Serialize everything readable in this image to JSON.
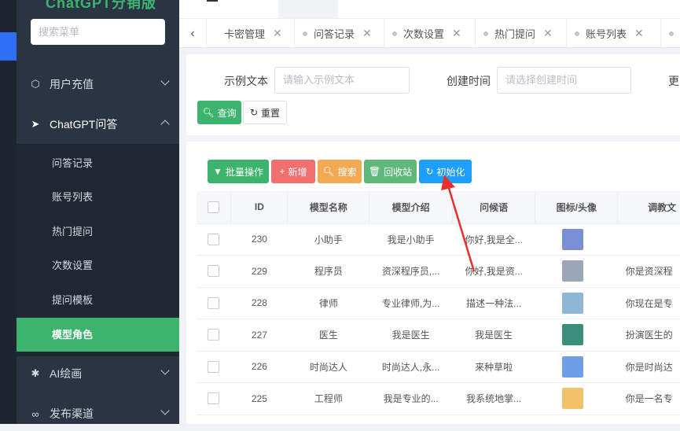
{
  "brand": "ChatGPT分销版",
  "menu_search_placeholder": "搜索菜单",
  "menu": {
    "recharge": "用户充值",
    "chatgpt": "ChatGPT问答",
    "sub": [
      "问答记录",
      "账号列表",
      "热门提问",
      "次数设置",
      "提问模板",
      "模型角色"
    ],
    "ai_draw": "AI绘画",
    "publish": "发布渠道"
  },
  "tabs": [
    {
      "label": "卡密管理",
      "icon": "chevron-left-icon"
    },
    {
      "label": "问答记录"
    },
    {
      "label": "次数设置"
    },
    {
      "label": "热门提问"
    },
    {
      "label": "账号列表"
    }
  ],
  "filter": {
    "sample_label": "示例文本",
    "sample_placeholder": "请输入示例文本",
    "created_label": "创建时间",
    "created_placeholder": "请选择创建时间",
    "more_label": "更",
    "query": "查询",
    "reset": "重置"
  },
  "toolbar": {
    "batch": "批量操作",
    "add": "新增",
    "search": "搜索",
    "recycle": "回收站",
    "init": "初始化"
  },
  "table": {
    "headers": [
      "ID",
      "模型名称",
      "模型介绍",
      "问候语",
      "图标/头像",
      "调教文"
    ],
    "rows": [
      {
        "id": "230",
        "name": "小助手",
        "intro": "我是小助手",
        "greet": "你好,我是全...",
        "desc": "",
        "color": "#7b8fd6"
      },
      {
        "id": "229",
        "name": "程序员",
        "intro": "资深程序员,...",
        "greet": "你好,我是资...",
        "desc": "你是资深程",
        "color": "#9aa7b6"
      },
      {
        "id": "228",
        "name": "律师",
        "intro": "专业律师,为...",
        "greet": "描述一种法...",
        "desc": "你现在是专",
        "color": "#8fb6d6"
      },
      {
        "id": "227",
        "name": "医生",
        "intro": "我是医生",
        "greet": "我是医生",
        "desc": "扮演医生的",
        "color": "#3a8f7a"
      },
      {
        "id": "226",
        "name": "时尚达人",
        "intro": "时尚达人,永...",
        "greet": "来种草啦",
        "desc": "你是时尚达",
        "color": "#6f9ee8"
      },
      {
        "id": "225",
        "name": "工程师",
        "intro": "我是专业的...",
        "greet": "我系统地掌...",
        "desc": "你是一名专",
        "color": "#f2c26b"
      }
    ]
  },
  "colors": {
    "accent": "#3cb46e",
    "sidebar": "#2b3442",
    "blue": "#1e9fff",
    "red": "#e84d4d"
  }
}
